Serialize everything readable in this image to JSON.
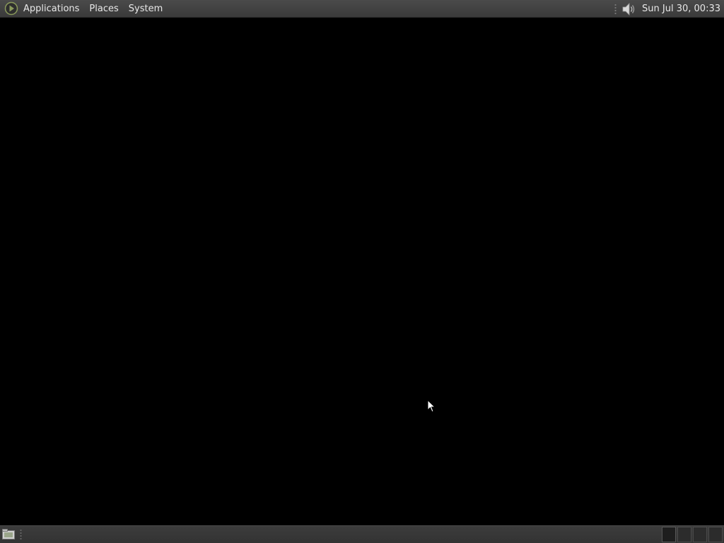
{
  "top_panel": {
    "menu": {
      "logo_icon": "main-menu-icon",
      "applications_label": "Applications",
      "places_label": "Places",
      "system_label": "System"
    },
    "tray": {
      "volume_icon": "speaker-volume-icon"
    },
    "clock": "Sun Jul 30, 00:33"
  },
  "bottom_panel": {
    "show_desktop_icon": "show-desktop-icon",
    "workspaces": [
      {
        "active": true
      },
      {
        "active": false
      },
      {
        "active": false
      },
      {
        "active": false
      }
    ]
  },
  "colors": {
    "desktop_background": "#000000",
    "panel_background": "#3e3e3e",
    "panel_text": "#e8e8e8",
    "logo_accent": "#8a9a5b"
  }
}
